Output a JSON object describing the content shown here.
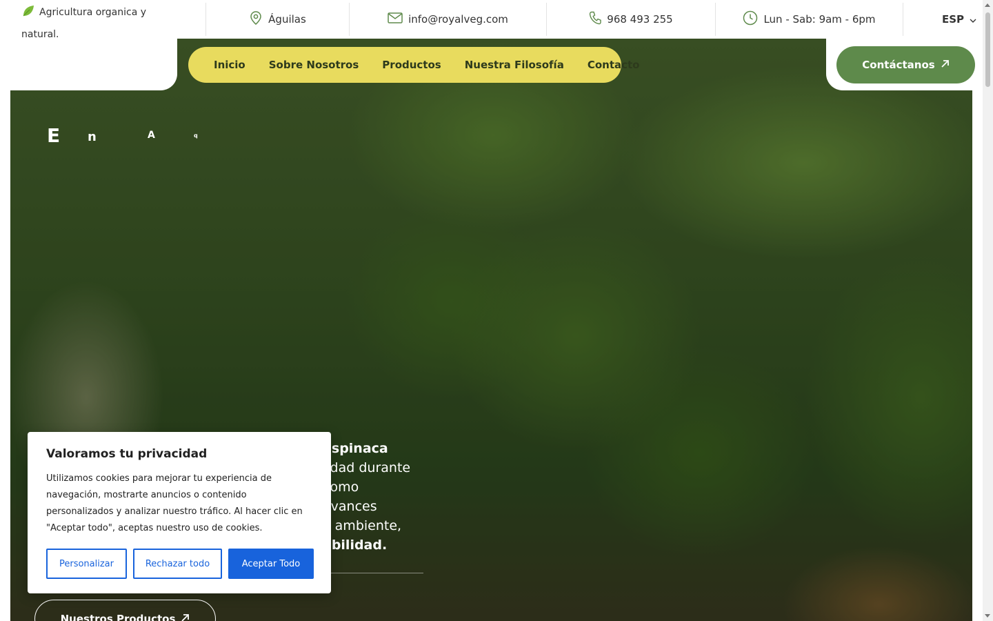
{
  "topbar": {
    "tagline": "Agricultura organica y natural.",
    "location": "Águilas",
    "email": "info@royalveg.com",
    "phone": "968 493 255",
    "hours": "Lun - Sab: 9am - 6pm",
    "language": "ESP"
  },
  "nav": {
    "items": [
      "Inicio",
      "Sobre Nosotros",
      "Productos",
      "Nuestra Filosofía",
      "Contacto"
    ],
    "cta_label": "Contáctanos"
  },
  "hero": {
    "letters": [
      "E",
      "n",
      "A",
      "q"
    ],
    "body_lines": [
      "espinaca",
      "lidad durante",
      "como",
      "avances",
      "o ambiente,",
      "abilidad."
    ],
    "button_label": "Nuestros Productos"
  },
  "cookie": {
    "title": "Valoramos tu privacidad",
    "text": "Utilizamos cookies para mejorar tu experiencia de navegación, mostrarte anuncios o contenido personalizados y analizar nuestro tráfico. Al hacer clic en \"Aceptar todo\", aceptas nuestro uso de cookies.",
    "customize": "Personalizar",
    "reject": "Rechazar todo",
    "accept": "Aceptar Todo"
  },
  "colors": {
    "accent_green": "#5e8a4b",
    "nav_yellow": "#e8db5e",
    "cookie_blue": "#1863dc",
    "icon_green": "#5e8a4b"
  },
  "icons": {
    "tagline": "leaf-icon",
    "location": "map-pin-icon",
    "email": "mail-icon",
    "phone": "phone-icon",
    "hours": "clock-icon",
    "language": "chevron-down-icon",
    "cta": "arrow-up-right-icon"
  }
}
